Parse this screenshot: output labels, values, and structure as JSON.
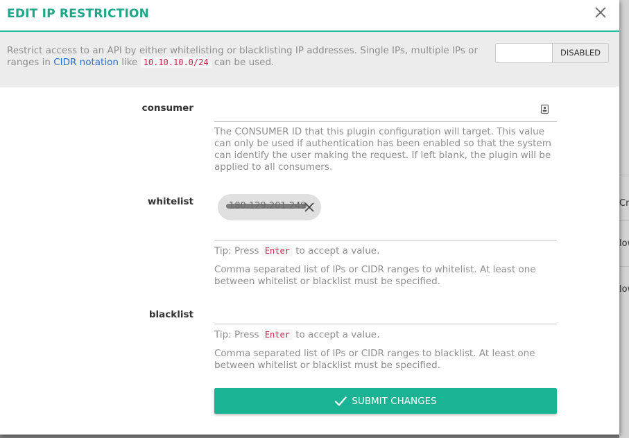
{
  "modal": {
    "title": "EDIT IP RESTRICTION",
    "close_icon": "close-icon"
  },
  "info": {
    "text_before_link": "Restrict access to an API by either whitelisting or blacklisting IP addresses. Single IPs, multiple IPs or ranges in ",
    "link": "CIDR notation",
    "text_after_link": " like ",
    "code": "10.10.10.0/24",
    "text_end": " can be used.",
    "toggle_label": "DISABLED",
    "link_color": "#2c6fc5"
  },
  "fields": {
    "consumer": {
      "label": "consumer",
      "value": "",
      "icon": "contact-card-icon",
      "help": "The CONSUMER ID that this plugin configuration will target. This value can only be used if authentication has been enabled so that the system can identify the user making the request. If left blank, the plugin will be applied to all consumers."
    },
    "whitelist": {
      "label": "whitelist",
      "chips": [
        {
          "value": "180.129.201.249",
          "redacted": true
        }
      ],
      "tip_before": "Tip: Press ",
      "tip_key": "Enter",
      "tip_after": " to accept a value.",
      "help": "Comma separated list of IPs or CIDR ranges to whitelist. At least one between whitelist or blacklist must be specified."
    },
    "blacklist": {
      "label": "blacklist",
      "tip_before": "Tip: Press ",
      "tip_key": "Enter",
      "tip_after": " to accept a value.",
      "help": "Comma separated list of IPs or CIDR ranges to blacklist. At least one between whitelist or blacklist must be specified."
    }
  },
  "submit": {
    "label": "SUBMIT CHANGES",
    "icon": "check-icon"
  },
  "background": {
    "fragments": [
      "Cre",
      "low",
      "low"
    ]
  },
  "colors": {
    "accent": "#1ab394",
    "title": "#1fa688",
    "code": "#c7254e"
  }
}
